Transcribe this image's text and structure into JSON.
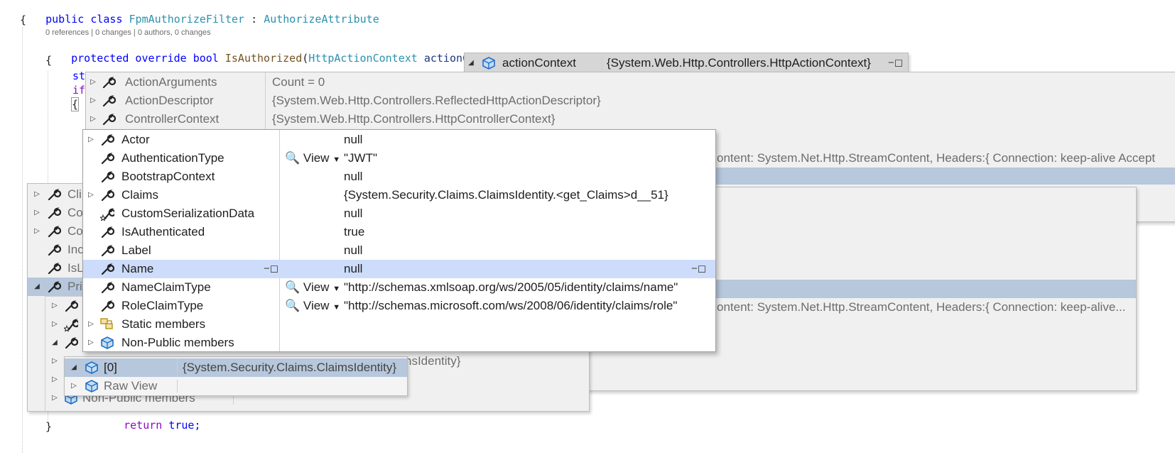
{
  "editor": {
    "line1_a": "public class ",
    "line1_class": "FpmAuthorizeFilter",
    "line1_b": " : ",
    "line1_base": "AuthorizeAttribute",
    "line2": "{",
    "codelens": "0 references | 0 changes | 0 authors, 0 changes",
    "line3_kw": "protected override bool ",
    "line3_method": "IsAuthorized",
    "line3_paren": "(",
    "line3_type": "HttpActionContext",
    "line3_param": " actionContext",
    "line3_close": ")",
    "line4": "{",
    "line5": "st",
    "line6": "if",
    "line7": "{",
    "ret_kw": "return",
    "ret_val": " true;",
    "close_brace": "}"
  },
  "tooltip_root": {
    "name": "actionContext",
    "value": "{System.Web.Http.Controllers.HttpActionContext}"
  },
  "panel_action": {
    "rows": [
      {
        "name": "ActionArguments",
        "value": "Count = 0"
      },
      {
        "name": "ActionDescriptor",
        "value": "{System.Web.Http.Controllers.ReflectedHttpActionDescriptor}"
      },
      {
        "name": "ControllerContext",
        "value": "{System.Web.Http.Controllers.HttpControllerContext}"
      }
    ],
    "partial_1": "ontent: System.Net.Http.StreamContent, Headers:{  Connection: keep-alive  Accept"
  },
  "panel_mid": {
    "partial_2": "ontent: System.Net.Http.StreamContent, Headers:{  Connection: keep-alive..."
  },
  "panel_left": {
    "rows": [
      {
        "name": "Cli"
      },
      {
        "name": "Co"
      },
      {
        "name": "Co"
      },
      {
        "name": "Inc"
      },
      {
        "name": "IsL"
      },
      {
        "name": "Pri"
      }
    ],
    "partial_value": "nsIdentity}",
    "nonpublic": "Non-Public members",
    "return_text": "return true;"
  },
  "panel_identity": {
    "rows": [
      {
        "name": "Actor",
        "value": "null",
        "expandable": true,
        "view": ""
      },
      {
        "name": "AuthenticationType",
        "value": "\"JWT\"",
        "expandable": false,
        "view": "View"
      },
      {
        "name": "BootstrapContext",
        "value": "null",
        "expandable": false,
        "view": ""
      },
      {
        "name": "Claims",
        "value": "{System.Security.Claims.ClaimsIdentity.<get_Claims>d__51}",
        "expandable": true,
        "view": ""
      },
      {
        "name": "CustomSerializationData",
        "value": "null",
        "expandable": false,
        "view": ""
      },
      {
        "name": "IsAuthenticated",
        "value": "true",
        "expandable": false,
        "view": ""
      },
      {
        "name": "Label",
        "value": "null",
        "expandable": false,
        "view": ""
      },
      {
        "name": "Name",
        "value": "null",
        "expandable": false,
        "view": ""
      },
      {
        "name": "NameClaimType",
        "value": "\"http://schemas.xmlsoap.org/ws/2005/05/identity/claims/name\"",
        "expandable": false,
        "view": "View"
      },
      {
        "name": "RoleClaimType",
        "value": "\"http://schemas.microsoft.com/ws/2008/06/identity/claims/role\"",
        "expandable": false,
        "view": "View"
      },
      {
        "name": "Static members",
        "value": "",
        "expandable": true,
        "view": ""
      },
      {
        "name": "Non-Public members",
        "value": "",
        "expandable": true,
        "view": ""
      }
    ]
  },
  "panel_identities": {
    "rows": [
      {
        "name": "[0]",
        "value": "{System.Security.Claims.ClaimsIdentity}"
      },
      {
        "name": "Raw View",
        "value": ""
      }
    ]
  },
  "colors": {
    "keyword": "#0000ff",
    "type": "#2b91af",
    "selection": "#b7c7dc",
    "selection_active": "#cddcfb"
  }
}
